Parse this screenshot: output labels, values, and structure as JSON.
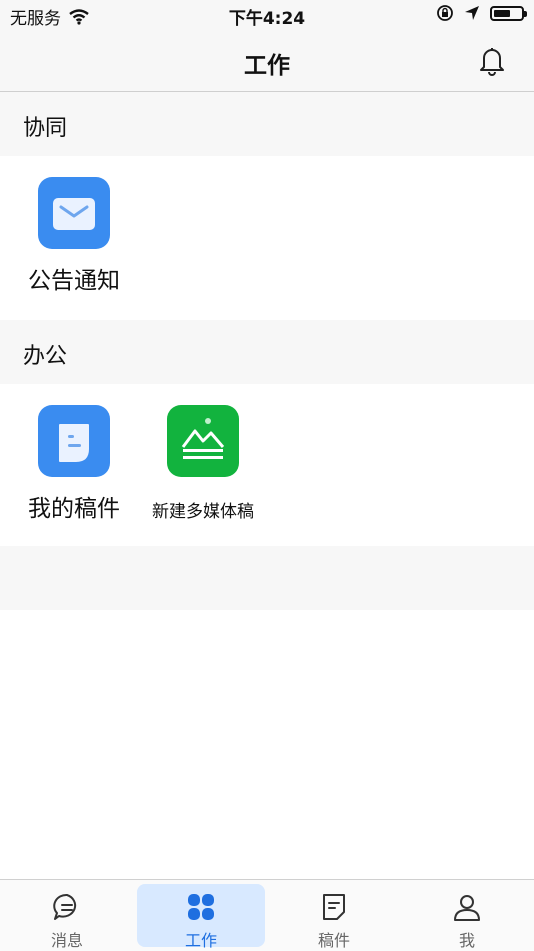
{
  "status_bar": {
    "carrier": "无服务",
    "time": "下午4:24",
    "battery_level": 0.6
  },
  "header": {
    "title": "工作"
  },
  "sections": [
    {
      "title": "协同",
      "apps": [
        {
          "label": "公告通知",
          "icon": "mail-icon"
        }
      ]
    },
    {
      "title": "办公",
      "apps": [
        {
          "label": "我的稿件",
          "icon": "document-icon"
        },
        {
          "label": "新建多媒体稿",
          "icon": "mountain-icon"
        }
      ]
    }
  ],
  "tabs": [
    {
      "label": "消息",
      "icon": "chat-icon",
      "active": false
    },
    {
      "label": "工作",
      "icon": "grid-icon",
      "active": true
    },
    {
      "label": "稿件",
      "icon": "note-icon",
      "active": false
    },
    {
      "label": "我",
      "icon": "person-icon",
      "active": false
    }
  ],
  "colors": {
    "accent": "#1f6fe0",
    "blue_icon": "#3a8cf0",
    "green_icon": "#12b33e",
    "active_tab_bg": "#d8e9ff"
  }
}
